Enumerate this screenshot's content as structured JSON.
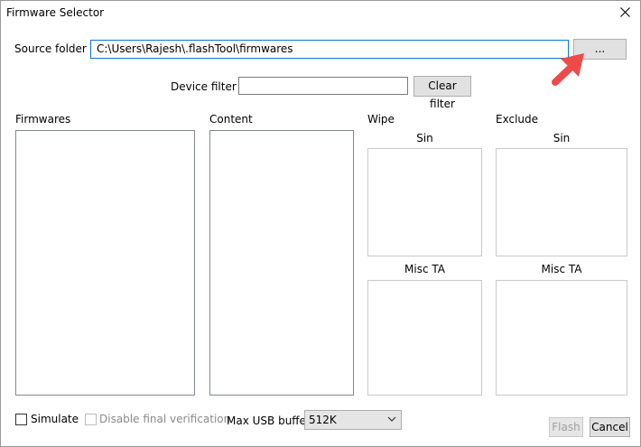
{
  "window": {
    "title": "Firmware Selector",
    "close_icon": "close-icon"
  },
  "source": {
    "label": "Source folder :",
    "value": "C:\\Users\\Rajesh\\.flashTool\\firmwares",
    "browse_label": "..."
  },
  "filter": {
    "label": "Device filter :",
    "value": "",
    "clear_label": "Clear filter"
  },
  "columns": {
    "firmwares": "Firmwares",
    "content": "Content",
    "wipe": "Wipe",
    "exclude": "Exclude"
  },
  "wipe": {
    "sin": "Sin",
    "misc_ta": "Misc TA"
  },
  "exclude": {
    "sin": "Sin",
    "misc_ta": "Misc TA"
  },
  "options": {
    "simulate_label": "Simulate",
    "simulate_checked": false,
    "disable_verification_label": "Disable final verification",
    "disable_verification_checked": false,
    "disable_verification_enabled": false,
    "max_usb_label": "Max USB buffer",
    "max_usb_value": "512K"
  },
  "actions": {
    "flash_label": "Flash",
    "flash_enabled": false,
    "cancel_label": "Cancel"
  },
  "annotation": {
    "arrow_color": "#ef4a4a",
    "arrow_icon": "red-arrow-icon"
  }
}
